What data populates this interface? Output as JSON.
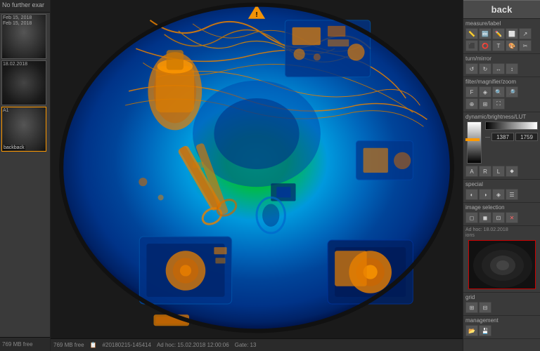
{
  "left_panel": {
    "no_further_label": "No further exar",
    "thumbnails": [
      {
        "id": "thumb-1",
        "date_line1": "Feb 15, 2018",
        "date_line2": "Feb 15, 2018",
        "label": "",
        "active": false
      },
      {
        "id": "thumb-2",
        "date_line1": "",
        "date_line2": "18.02.2018",
        "label": "",
        "active": false
      },
      {
        "id": "thumb-3",
        "date_line1": "A1",
        "date_line2": "backback",
        "label": "backback",
        "active": true
      }
    ]
  },
  "main_area": {
    "warning_visible": true,
    "status_bar": {
      "file_info": "769 MB free",
      "scan_id": "#20180215-145414",
      "ad_hoc": "Ad hoc: 15.02.2018 12:00:06",
      "date": "Gate: 13"
    }
  },
  "right_panel": {
    "back_label": "back",
    "sections": [
      {
        "id": "measure-label",
        "label": "measure/label",
        "tools": [
          "ruler",
          "label",
          "pencil",
          "eraser",
          "arrow",
          "box",
          "circle",
          "text",
          "color"
        ]
      },
      {
        "id": "turn-mirror",
        "label": "turn/mirror",
        "tools": []
      },
      {
        "id": "filter-magnifier-zoom",
        "label": "filter/magnifier/zoom",
        "tools": [
          "filter1",
          "filter2",
          "zoom-in",
          "zoom-out",
          "magnifier",
          "fit"
        ]
      },
      {
        "id": "dynamic-brightness-lut",
        "label": "dynamic/brightness/LUT",
        "slider_min": "0",
        "slider_max": "1759",
        "slider_value": "1387"
      },
      {
        "id": "special",
        "label": "special",
        "tools": [
          "special1",
          "special2",
          "special3",
          "special4"
        ]
      },
      {
        "id": "image-selection",
        "label": "image selection",
        "tools": [
          "select1",
          "select2",
          "select3",
          "delete"
        ]
      }
    ],
    "ad_hoc_section": {
      "label": "Ad hoc: 18.02.2018",
      "sub_label": "ions"
    },
    "bottom_sections": [
      {
        "id": "grid",
        "label": "grid"
      },
      {
        "id": "management",
        "label": "management"
      }
    ]
  }
}
